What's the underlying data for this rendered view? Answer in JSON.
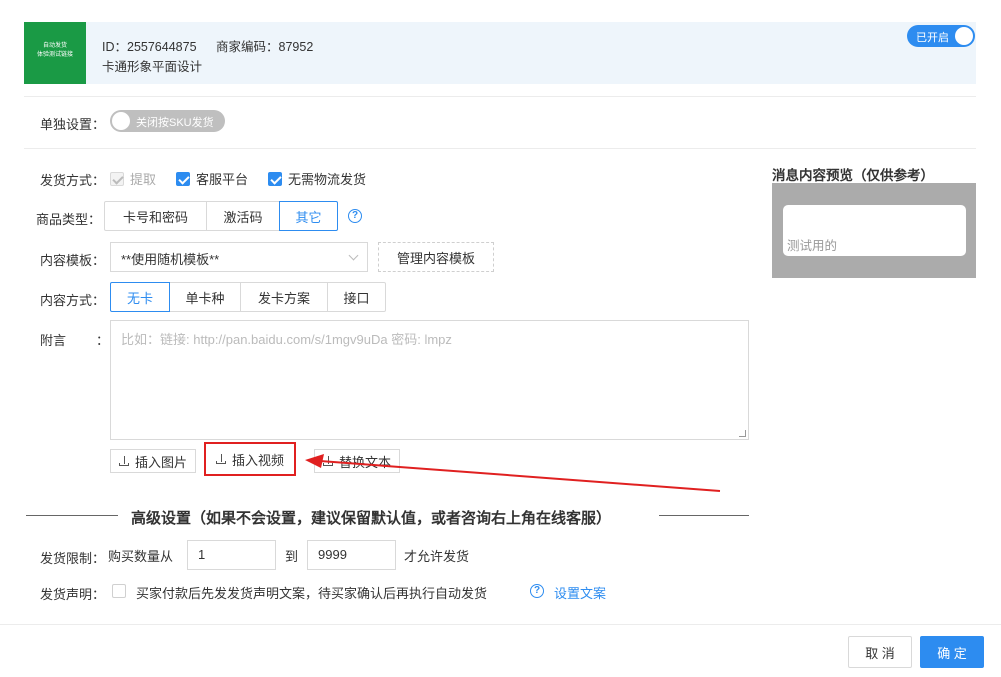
{
  "header": {
    "thumb_line1": "自动发货",
    "thumb_line2": "体验测试链接",
    "id_label": "ID：2557644875",
    "merchant_code": "商家编码：87952",
    "product_name": "卡通形象平面设计",
    "enabled_label": "已开启"
  },
  "single_setting": {
    "label": "单独设置：",
    "toggle_label": "关闭按SKU发货"
  },
  "delivery_method": {
    "label": "发货方式：",
    "options": [
      {
        "label": "提取",
        "state": "disabled-checked"
      },
      {
        "label": "客服平台",
        "state": "checked"
      },
      {
        "label": "无需物流发货",
        "state": "checked"
      }
    ]
  },
  "product_type": {
    "label": "商品类型：",
    "options": [
      "卡号和密码",
      "激活码",
      "其它"
    ],
    "selected": "其它"
  },
  "content_template": {
    "label": "内容模板：",
    "selected_value": "**使用随机模板**",
    "manage_button": "管理内容模板"
  },
  "content_method": {
    "label": "内容方式：",
    "options": [
      "无卡",
      "单卡种",
      "发卡方案",
      "接口"
    ],
    "selected": "无卡"
  },
  "note": {
    "label": "附言",
    "colon": "：",
    "placeholder": "比如：链接: http://pan.baidu.com/s/1mgv9uDa 密码: lmpz",
    "buttons": [
      "插入图片",
      "插入视频",
      "替换文本"
    ]
  },
  "advanced": {
    "title": "高级设置（如果不会设置，建议保留默认值，或者咨询右上角在线客服）",
    "limit_label": "发货限制：",
    "limit_prefix": "购买数量从",
    "limit_from": "1",
    "limit_to_label": "到",
    "limit_to": "9999",
    "limit_suffix": "才允许发货",
    "statement_label": "发货声明：",
    "statement_text": "买家付款后先发发货声明文案，待买家确认后再执行自动发货",
    "statement_link": "设置文案"
  },
  "preview": {
    "title": "消息内容预览（仅供参考）",
    "message": "测试用的"
  },
  "footer": {
    "cancel": "取 消",
    "ok": "确 定"
  },
  "colors": {
    "accent": "#2d8cf0",
    "thumb_green": "#1a9a45",
    "highlight_red": "#e02020"
  }
}
